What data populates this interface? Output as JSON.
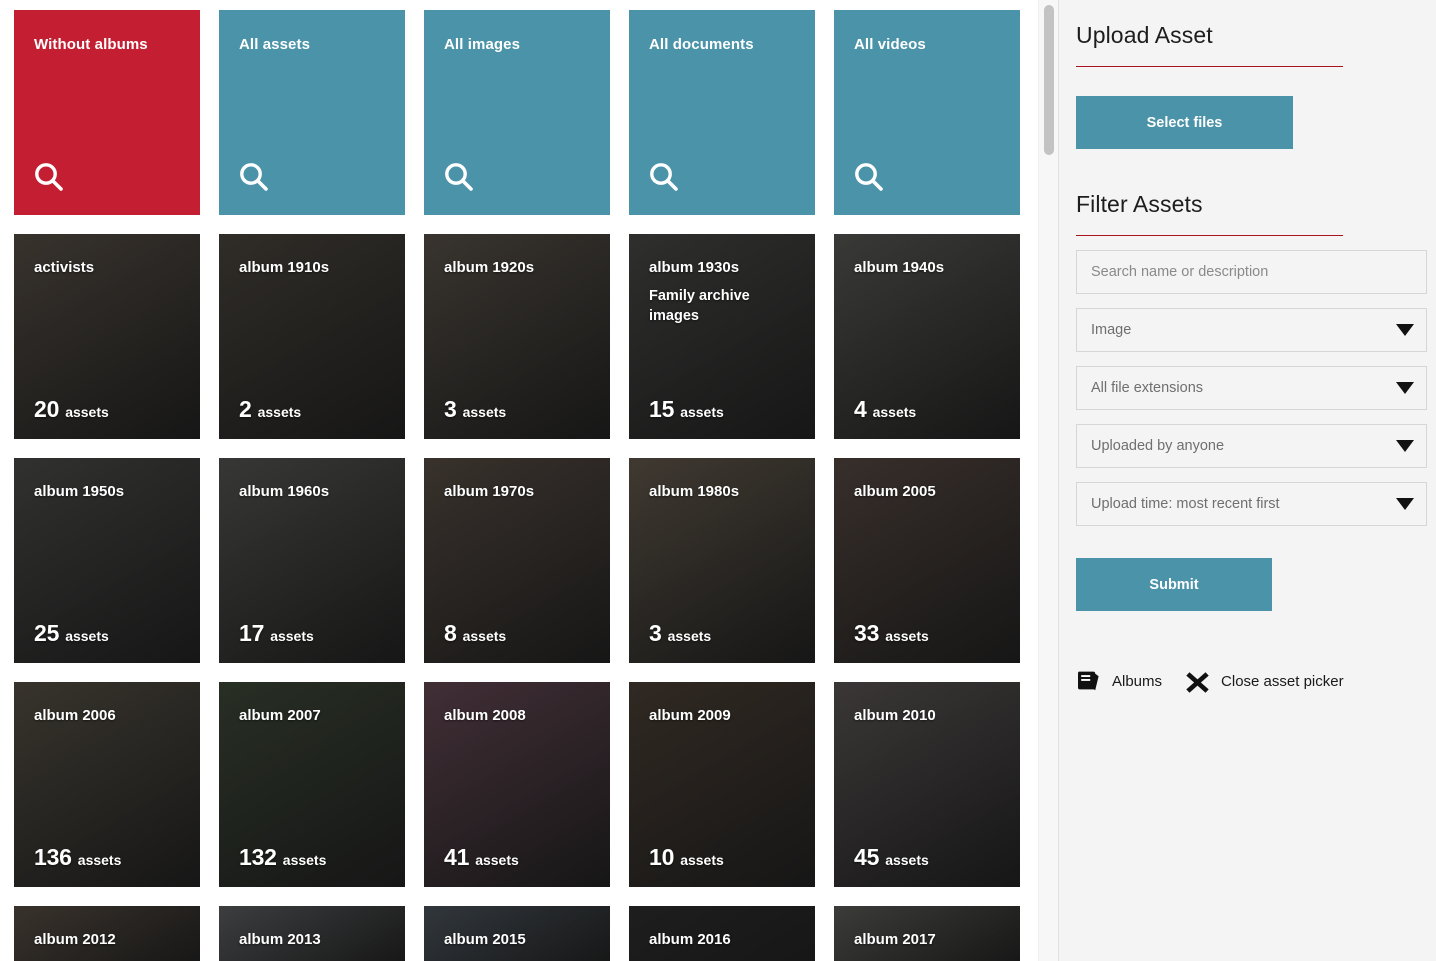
{
  "shortcut_tiles": [
    {
      "label": "Without albums",
      "color": "#c41e32",
      "icon": "search-icon"
    },
    {
      "label": "All assets",
      "color": "#4a93a8",
      "icon": "search-icon"
    },
    {
      "label": "All images",
      "color": "#4a93a8",
      "icon": "search-icon"
    },
    {
      "label": "All documents",
      "color": "#4a93a8",
      "icon": "search-icon"
    },
    {
      "label": "All videos",
      "color": "#4a93a8",
      "icon": "search-icon"
    }
  ],
  "assets_word": "assets",
  "albums": [
    {
      "title": "activists",
      "description": "",
      "count": "20",
      "tone": "#6b6156",
      "cut": false
    },
    {
      "title": "album 1910s",
      "description": "",
      "count": "2",
      "tone": "#5d564c",
      "cut": false
    },
    {
      "title": "album 1920s",
      "description": "",
      "count": "3",
      "tone": "#6d6459",
      "cut": false
    },
    {
      "title": "album 1930s",
      "description": "Family archive images",
      "count": "15",
      "tone": "#5a5a58",
      "cut": false
    },
    {
      "title": "album 1940s",
      "description": "",
      "count": "4",
      "tone": "#6e6e6a",
      "cut": false
    },
    {
      "title": "album 1950s",
      "description": "",
      "count": "25",
      "tone": "#5e5e5c",
      "cut": false
    },
    {
      "title": "album 1960s",
      "description": "",
      "count": "17",
      "tone": "#6a6a66",
      "cut": false
    },
    {
      "title": "album 1970s",
      "description": "",
      "count": "8",
      "tone": "#6d5f55",
      "cut": false
    },
    {
      "title": "album 1980s",
      "description": "",
      "count": "3",
      "tone": "#7a6e5e",
      "cut": false
    },
    {
      "title": "album 2005",
      "description": "",
      "count": "33",
      "tone": "#6b5a52",
      "cut": false
    },
    {
      "title": "album 2006",
      "description": "",
      "count": "136",
      "tone": "#6b6456",
      "cut": false
    },
    {
      "title": "album 2007",
      "description": "",
      "count": "132",
      "tone": "#4d5a46",
      "cut": false
    },
    {
      "title": "album 2008",
      "description": "",
      "count": "41",
      "tone": "#7d5a68",
      "cut": false
    },
    {
      "title": "album 2009",
      "description": "",
      "count": "10",
      "tone": "#5e4f42",
      "cut": false
    },
    {
      "title": "album 2010",
      "description": "",
      "count": "45",
      "tone": "#71696a",
      "cut": false
    },
    {
      "title": "album 2012",
      "description": "",
      "count": "",
      "tone": "#6d6154",
      "cut": true
    },
    {
      "title": "album 2013",
      "description": "",
      "count": "",
      "tone": "#74767a",
      "cut": true
    },
    {
      "title": "album 2015",
      "description": "",
      "count": "",
      "tone": "#5f6a74",
      "cut": true
    },
    {
      "title": "album 2016",
      "description": "",
      "count": "",
      "tone": "#3a3a3c",
      "cut": true
    },
    {
      "title": "album 2017",
      "description": "",
      "count": "",
      "tone": "#72726e",
      "cut": true
    }
  ],
  "sidebar": {
    "upload": {
      "heading": "Upload Asset",
      "select_files_label": "Select files"
    },
    "filter": {
      "heading": "Filter Assets",
      "search_placeholder": "Search name or description",
      "search_value": "",
      "asset_type": "Image",
      "file_extension": "All file extensions",
      "uploaded_by": "Uploaded by anyone",
      "sort_order": "Upload time: most recent first",
      "submit_label": "Submit"
    },
    "actions": [
      {
        "label": "Albums",
        "icon": "book-icon"
      },
      {
        "label": "Close asset picker",
        "icon": "close-icon"
      }
    ]
  },
  "colors": {
    "accent_teal": "#4a93a8",
    "accent_red": "#c41e32",
    "rule_red": "#a8141f",
    "sidebar_bg": "#f4f4f4"
  }
}
